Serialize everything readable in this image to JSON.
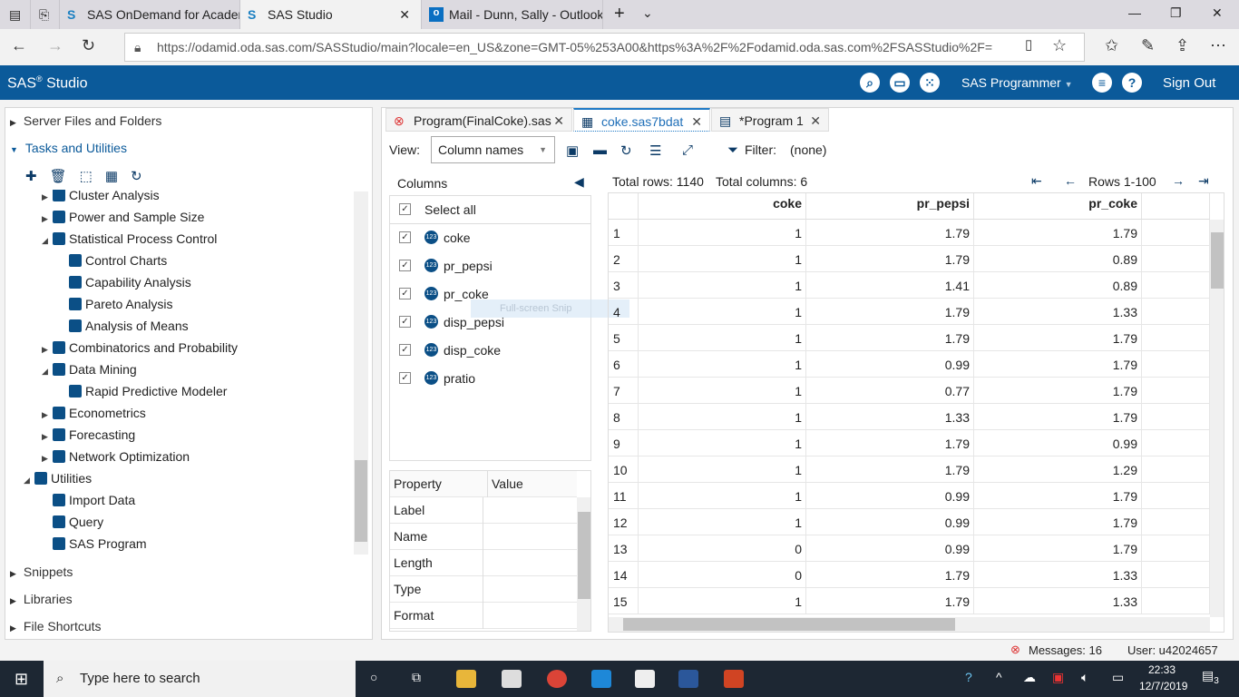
{
  "browser": {
    "tabs": [
      {
        "label": "SAS OnDemand for Academ"
      },
      {
        "label": "SAS Studio"
      },
      {
        "label": "Mail - Dunn, Sally - Outlook"
      }
    ],
    "url": "https://odamid.oda.sas.com/SASStudio/main?locale=en_US&zone=GMT-05%253A00&https%3A%2F%2Fodamid.oda.sas.com%2FSASStudio%2F="
  },
  "header": {
    "title": "SAS",
    "title_reg": "®",
    "title_rest": " Studio",
    "perspective": "SAS Programmer",
    "sign_out": "Sign Out"
  },
  "left": {
    "sections": [
      "Server Files and Folders",
      "Tasks and Utilities",
      "Snippets",
      "Libraries",
      "File Shortcuts"
    ],
    "tree": [
      {
        "label": "Cluster Analysis",
        "level": 1,
        "arrow": "▶"
      },
      {
        "label": "Power and Sample Size",
        "level": 1,
        "arrow": "▶"
      },
      {
        "label": "Statistical Process Control",
        "level": 1,
        "arrow": "◢"
      },
      {
        "label": "Control Charts",
        "level": 2,
        "arrow": ""
      },
      {
        "label": "Capability Analysis",
        "level": 2,
        "arrow": ""
      },
      {
        "label": "Pareto Analysis",
        "level": 2,
        "arrow": ""
      },
      {
        "label": "Analysis of Means",
        "level": 2,
        "arrow": ""
      },
      {
        "label": "Combinatorics and Probability",
        "level": 1,
        "arrow": "▶"
      },
      {
        "label": "Data Mining",
        "level": 1,
        "arrow": "◢"
      },
      {
        "label": "Rapid Predictive Modeler",
        "level": 2,
        "arrow": ""
      },
      {
        "label": "Econometrics",
        "level": 1,
        "arrow": "▶"
      },
      {
        "label": "Forecasting",
        "level": 1,
        "arrow": "▶"
      },
      {
        "label": "Network Optimization",
        "level": 1,
        "arrow": "▶"
      },
      {
        "label": "Utilities",
        "level": 0,
        "arrow": "◢"
      },
      {
        "label": "Import Data",
        "level": 1,
        "arrow": ""
      },
      {
        "label": "Query",
        "level": 1,
        "arrow": ""
      },
      {
        "label": "SAS Program",
        "level": 1,
        "arrow": ""
      }
    ]
  },
  "editor": {
    "tabs": [
      {
        "label": "Program(FinalCoke).sas"
      },
      {
        "label": "coke.sas7bdat"
      },
      {
        "label": "*Program 1"
      }
    ],
    "view_label": "View:",
    "view_value": "Column names",
    "filter_label": "Filter:",
    "filter_value": "(none)",
    "columns_title": "Columns",
    "select_all": "Select all",
    "columns": [
      "coke",
      "pr_pepsi",
      "pr_coke",
      "disp_pepsi",
      "disp_coke",
      "pratio"
    ],
    "snip_overlay": "Full-screen Snip",
    "property_header": "Property",
    "value_header": "Value",
    "properties": [
      "Label",
      "Name",
      "Length",
      "Type",
      "Format"
    ],
    "total_rows": "Total rows: 1140",
    "total_columns": "Total columns: 6",
    "rows_range": "Rows 1-100",
    "grid_headers": [
      "coke",
      "pr_pepsi",
      "pr_coke"
    ],
    "rows": [
      [
        "1",
        "1",
        "1.79",
        "1.79"
      ],
      [
        "2",
        "1",
        "1.79",
        "0.89"
      ],
      [
        "3",
        "1",
        "1.41",
        "0.89"
      ],
      [
        "4",
        "1",
        "1.79",
        "1.33"
      ],
      [
        "5",
        "1",
        "1.79",
        "1.79"
      ],
      [
        "6",
        "1",
        "0.99",
        "1.79"
      ],
      [
        "7",
        "1",
        "0.77",
        "1.79"
      ],
      [
        "8",
        "1",
        "1.33",
        "1.79"
      ],
      [
        "9",
        "1",
        "1.79",
        "0.99"
      ],
      [
        "10",
        "1",
        "1.79",
        "1.29"
      ],
      [
        "11",
        "1",
        "0.99",
        "1.79"
      ],
      [
        "12",
        "1",
        "0.99",
        "1.79"
      ],
      [
        "13",
        "0",
        "0.99",
        "1.79"
      ],
      [
        "14",
        "0",
        "1.79",
        "1.33"
      ],
      [
        "15",
        "1",
        "1.79",
        "1.33"
      ]
    ]
  },
  "status": {
    "messages": "Messages: 16",
    "user": "User: u42024657"
  },
  "taskbar": {
    "search_placeholder": "Type here to search",
    "time": "22:33",
    "date": "12/7/2019",
    "notifications": "3"
  }
}
